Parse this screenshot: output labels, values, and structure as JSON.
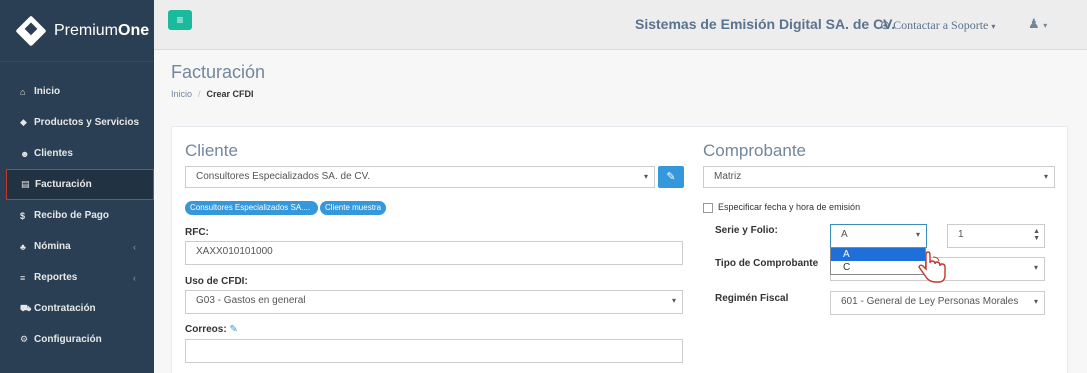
{
  "sidebar": {
    "brand_light": "Premium",
    "brand_bold": "One",
    "items": [
      {
        "icon": "home-icon",
        "glyph": "⌂",
        "label": "Inicio",
        "chevron": ""
      },
      {
        "icon": "tag-icon",
        "glyph": "◆",
        "label": "Productos y Servicios",
        "chevron": ""
      },
      {
        "icon": "users-icon",
        "glyph": "☻",
        "label": "Clientes",
        "chevron": ""
      },
      {
        "icon": "file-icon",
        "glyph": "▤",
        "label": "Facturación",
        "chevron": ""
      },
      {
        "icon": "dollar-icon",
        "glyph": "$",
        "label": "Recibo de Pago",
        "chevron": ""
      },
      {
        "icon": "sitemap-icon",
        "glyph": "♣",
        "label": "Nómina",
        "chevron": "‹"
      },
      {
        "icon": "list-icon",
        "glyph": "≡",
        "label": "Reportes",
        "chevron": "‹"
      },
      {
        "icon": "cart-icon",
        "glyph": "⛟",
        "label": "Contratación",
        "chevron": ""
      },
      {
        "icon": "cogs-icon",
        "glyph": "⚙",
        "label": "Configuración",
        "chevron": ""
      }
    ]
  },
  "topbar": {
    "menu_glyph": "≡",
    "company": "Sistemas de Emisión Digital SA. de CV.",
    "support": "Contactar a Soporte",
    "support_glyph": "⊕",
    "support_caret": "▾",
    "user_glyph": "♟",
    "user_caret": "▾"
  },
  "page": {
    "title": "Facturación",
    "breadcrumb_home": "Inicio",
    "breadcrumb_sep": "/",
    "breadcrumb_current": "Crear CFDI"
  },
  "cliente": {
    "title": "Cliente",
    "select_value": "Consultores Especializados SA. de CV.",
    "edit_glyph": "✎",
    "tags": [
      "Consultores Especializados SA....",
      "Cliente muestra"
    ],
    "rfc_label": "RFC:",
    "rfc_value": "XAXX010101000",
    "uso_label": "Uso de CFDI:",
    "uso_value": "G03 - Gastos en general",
    "correos_label": "Correos:",
    "correos_glyph": "✎",
    "correos_value": ""
  },
  "comprobante": {
    "title": "Comprobante",
    "sucursal_value": "Matriz",
    "fecha_label": "Especificar fecha y hora de emisión",
    "serie_label": "Serie y Folio:",
    "serie_value": "A",
    "serie_options": [
      "A",
      "C"
    ],
    "folio_value": "1",
    "tipo_label": "Tipo de Comprobante",
    "tipo_value": "",
    "regimen_label": "Regimén Fiscal",
    "regimen_value": "601 - General de Ley Personas Morales"
  },
  "glyphs": {
    "caret": "▾",
    "spin_up": "▲",
    "spin_down": "▼"
  },
  "colors": {
    "sidebar": "#2a3f54",
    "accent": "#1abb9c",
    "primary": "#3498db",
    "active_outline": "#c0392b"
  }
}
